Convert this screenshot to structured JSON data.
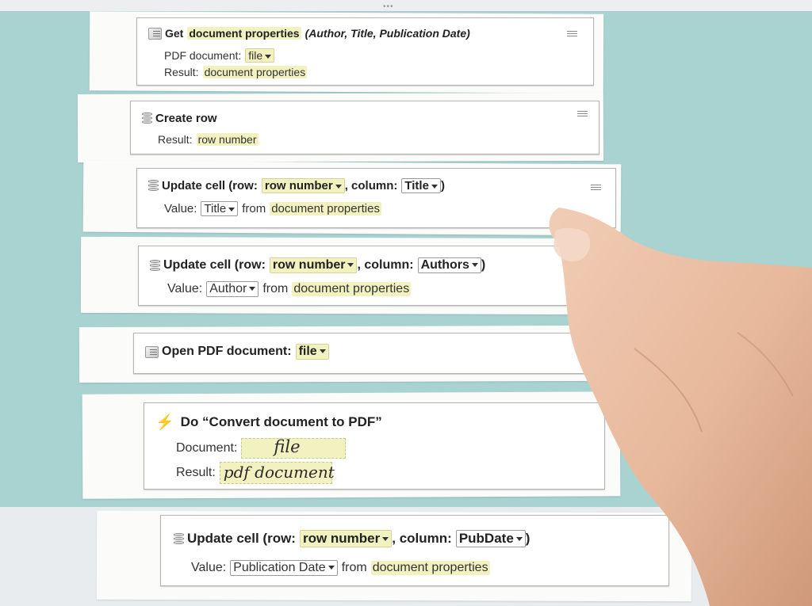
{
  "cards": {
    "get_props": {
      "title_prefix": "Get",
      "title_value": "document properties",
      "title_suffix": "(Author, Title, Publication Date)",
      "pdf_label": "PDF document:",
      "pdf_value": "file",
      "result_label": "Result:",
      "result_value": "document properties"
    },
    "create_row": {
      "title": "Create row",
      "result_label": "Result:",
      "result_value": "row number"
    },
    "update_title": {
      "title_prefix": "Update cell (row:",
      "row_value": "row number",
      "column_label": ", column:",
      "column_value": "Title",
      "close_paren": ")",
      "value_label": "Value:",
      "value_value": "Title",
      "from_label": "from",
      "from_value": "document properties"
    },
    "update_authors": {
      "title_prefix": "Update cell (row:",
      "row_value": "row number",
      "column_label": ", column:",
      "column_value": "Authors",
      "close_paren": ")",
      "value_label": "Value:",
      "value_value": "Author",
      "from_label": "from",
      "from_value": "document properties"
    },
    "open_pdf": {
      "title": "Open PDF document:",
      "value": "file"
    },
    "convert": {
      "title": "Do “Convert document to PDF”",
      "document_label": "Document:",
      "document_handwritten": "file",
      "result_label": "Result:",
      "result_handwritten": "pdf document"
    },
    "update_pubdate": {
      "title_prefix": "Update cell (row:",
      "row_value": "row number",
      "column_label": ", column:",
      "column_value": "PubDate",
      "close_paren": ")",
      "value_label": "Value:",
      "value_value": "Publication Date",
      "from_label": "from",
      "from_value": "document properties"
    }
  },
  "icons": {
    "get_props": "pdf-icon",
    "create_row": "database-icon",
    "update": "database-icon",
    "open_pdf": "pdf-icon",
    "convert": "lightning-bolt-icon",
    "menu": "hamburger-menu-icon"
  },
  "colors": {
    "background": "#a9d3d1",
    "highlight": "#f2f1c0",
    "paper": "#ffffff"
  }
}
